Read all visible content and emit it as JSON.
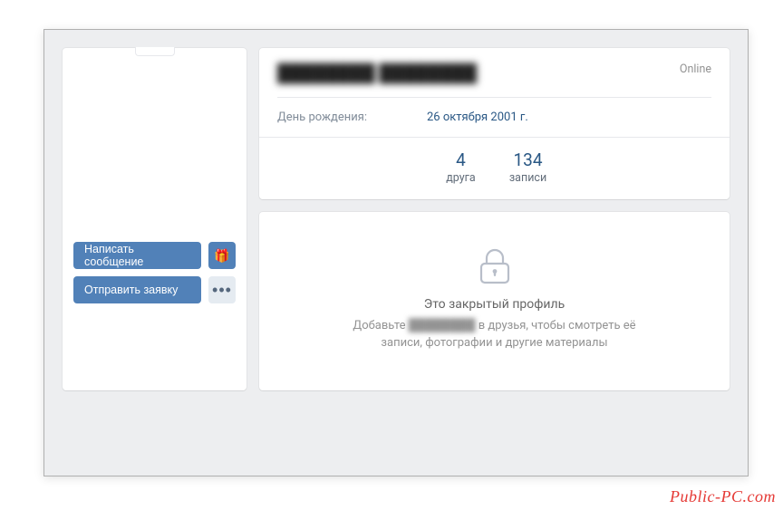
{
  "sidebar": {
    "message_button": "Написать сообщение",
    "gift_icon": "🎁",
    "friend_request_button": "Отправить заявку",
    "more_icon": "•••"
  },
  "profile": {
    "name": "████████ ████████",
    "status": "Online",
    "birthday_label": "День рождения:",
    "birthday_value": "26 октября 2001 г."
  },
  "counters": [
    {
      "value": "4",
      "label": "друга"
    },
    {
      "value": "134",
      "label": "записи"
    }
  ],
  "private": {
    "title": "Это закрытый профиль",
    "msg_prefix": "Добавьте ",
    "msg_name": "████████",
    "msg_suffix": " в друзья, чтобы смотреть её записи, фотографии и другие материалы"
  },
  "watermark": "Public-PC.com"
}
